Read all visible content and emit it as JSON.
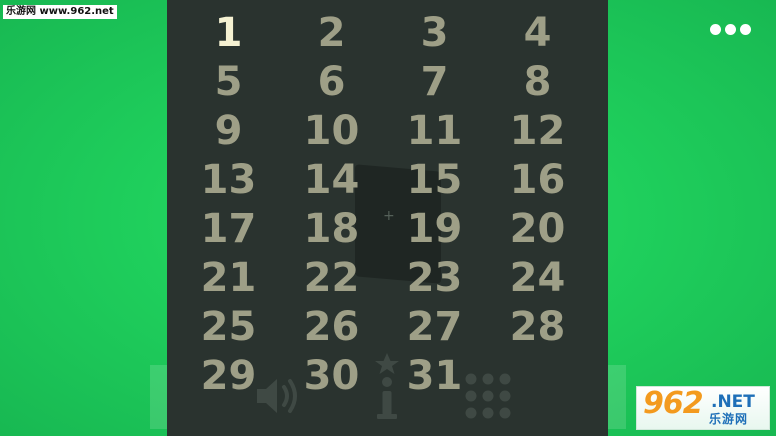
{
  "watermark": {
    "top_left": "乐游网 www.962.net",
    "badge_number": "962",
    "badge_net": ".NET",
    "badge_cn": "乐游网"
  },
  "menu": {
    "icon": "more-dots-icon"
  },
  "levels": {
    "current": "1",
    "items": [
      "1",
      "2",
      "3",
      "4",
      "5",
      "6",
      "7",
      "8",
      "9",
      "10",
      "11",
      "12",
      "13",
      "14",
      "15",
      "16",
      "17",
      "18",
      "19",
      "20",
      "21",
      "22",
      "23",
      "24",
      "25",
      "26",
      "27",
      "28",
      "29",
      "30",
      "31"
    ]
  },
  "bottom_icons": [
    "speaker-icon",
    "info-icon",
    "level-grid-icon"
  ],
  "colors": {
    "background": "#1fcf5c",
    "overlay": "#2a332f",
    "level_text": "#9e9f87",
    "level_current": "#f5f1d2",
    "badge_orange": "#f39a1e",
    "badge_blue": "#1e6fb8"
  }
}
